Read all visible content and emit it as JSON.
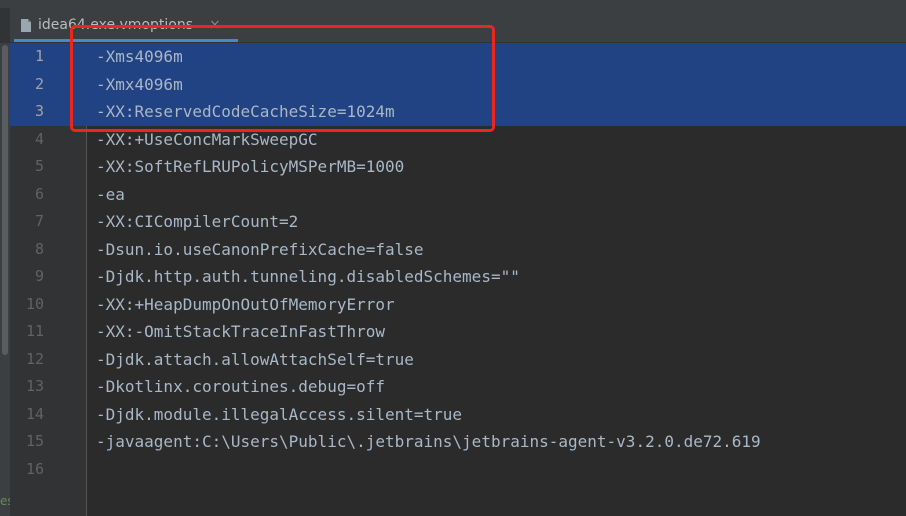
{
  "tab": {
    "filename": "idea64.exe.vmoptions",
    "close_glyph": "×"
  },
  "editor": {
    "lines": [
      {
        "num": "1",
        "text": "-Xms4096m",
        "selected": true
      },
      {
        "num": "2",
        "text": "-Xmx4096m",
        "selected": true
      },
      {
        "num": "3",
        "text": "-XX:ReservedCodeCacheSize=1024m",
        "selected": true
      },
      {
        "num": "4",
        "text": "-XX:+UseConcMarkSweepGC",
        "selected": false
      },
      {
        "num": "5",
        "text": "-XX:SoftRefLRUPolicyMSPerMB=1000",
        "selected": false
      },
      {
        "num": "6",
        "text": "-ea",
        "selected": false
      },
      {
        "num": "7",
        "text": "-XX:CICompilerCount=2",
        "selected": false
      },
      {
        "num": "8",
        "text": "-Dsun.io.useCanonPrefixCache=false",
        "selected": false
      },
      {
        "num": "9",
        "text": "-Djdk.http.auth.tunneling.disabledSchemes=\"\"",
        "selected": false
      },
      {
        "num": "10",
        "text": "-XX:+HeapDumpOnOutOfMemoryError",
        "selected": false
      },
      {
        "num": "11",
        "text": "-XX:-OmitStackTraceInFastThrow",
        "selected": false
      },
      {
        "num": "12",
        "text": "-Djdk.attach.allowAttachSelf=true",
        "selected": false
      },
      {
        "num": "13",
        "text": "-Dkotlinx.coroutines.debug=off",
        "selected": false
      },
      {
        "num": "14",
        "text": "-Djdk.module.illegalAccess.silent=true",
        "selected": false
      },
      {
        "num": "15",
        "text": "-javaagent:C:\\Users\\Public\\.jetbrains\\jetbrains-agent-v3.2.0.de72.619",
        "selected": false
      },
      {
        "num": "16",
        "text": "",
        "selected": false
      }
    ]
  },
  "side_label": "es",
  "colors": {
    "selection": "#214283",
    "highlight_box": "#e8271d",
    "tab_accent": "#4a88c7"
  }
}
